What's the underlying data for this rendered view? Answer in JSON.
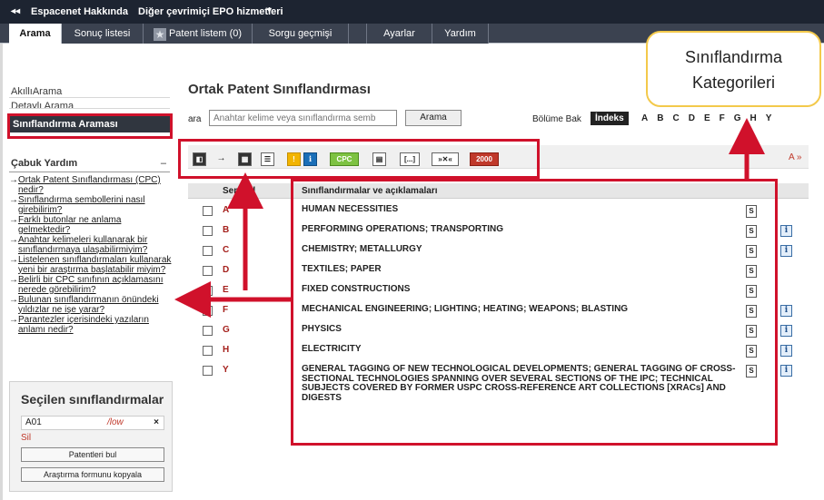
{
  "topbar": {
    "home_glyph": "◂◂",
    "espacenet_about": "Espacenet Hakkında",
    "other_services": "Diğer çevrimiçi EPO hizmetleri",
    "dropdown_caret": "▼"
  },
  "tabs": [
    {
      "label": "Arama",
      "active": true
    },
    {
      "label": "Sonuç listesi",
      "active": false
    },
    {
      "label": "Patent listem (0)",
      "active": false,
      "icon": "star-icon"
    },
    {
      "label": "Sorgu geçmişi",
      "active": false
    },
    {
      "label": "Ayarlar",
      "active": false
    },
    {
      "label": "Yardım",
      "active": false
    }
  ],
  "left_nav": {
    "items": [
      "AkıllıArama",
      "Detaylı Arama"
    ],
    "selected": "Sınıflandırma Araması"
  },
  "quick_help": {
    "title": "Çabuk Yardım",
    "collapse": "–",
    "links": [
      "Ortak Patent Sınıflandırması (CPC) nedir?",
      "Sınıflandırma sembollerini nasıl girebilirim?",
      "Farklı butonlar ne anlama gelmektedir?",
      "Anahtar kelimeleri kullanarak bir sınıflandırmaya ulaşabilirmiyim?",
      "Listelenen sınıflandırmaları kullanarak yeni bir araştırma başlatabilir miyim?",
      "Belirli bir CPC sınıfının açıklamasını nerede görebilirim?",
      "Bulunan sınıflandırmanın önündeki yıldızlar ne işe yarar?",
      "Parantezler içerisindeki yazıların anlamı nedir?"
    ]
  },
  "selected_panel": {
    "title": "Seçilen sınıflandırmalar",
    "item_code": "A01",
    "item_op": "/low",
    "remove": "×",
    "delete_label": "Sil",
    "find_patents": "Patentleri bul",
    "copy_form": "Araştırma formunu kopyala"
  },
  "main": {
    "title": "Ortak Patent Sınıflandırması",
    "search_label": "ara",
    "search_placeholder": "Anahtar kelime veya sınıflandırma semb",
    "search_button": "Arama",
    "section_label": "Bölüme Bak",
    "index_label": "İndeks",
    "section_letters": [
      "A",
      "B",
      "C",
      "D",
      "E",
      "F",
      "G",
      "H",
      "Y"
    ],
    "font_link": "A »"
  },
  "toolbar": {
    "items": [
      {
        "name": "collapse-all-icon",
        "glyph": "◧"
      },
      {
        "name": "go-to-icon",
        "glyph": "→"
      },
      {
        "name": "expand-view-icon",
        "glyph": "▦"
      },
      {
        "name": "list-view-icon",
        "glyph": "☰"
      },
      {
        "name": "warning-icon",
        "glyph": "!"
      },
      {
        "name": "info-icon",
        "glyph": "i"
      },
      {
        "name": "cpc-icon",
        "glyph": "CPC"
      },
      {
        "name": "table-icon",
        "glyph": "▤"
      },
      {
        "name": "brackets-icon",
        "glyph": "[...]"
      },
      {
        "name": "concordance-icon",
        "glyph": "»✕«"
      },
      {
        "name": "year-2000-icon",
        "glyph": "2000"
      }
    ]
  },
  "table": {
    "headers": [
      "Sembol",
      "Sınıflandırmalar ve açıklamaları"
    ],
    "rows": [
      {
        "symbol": "A",
        "desc": "HUMAN NECESSITIES",
        "info": false
      },
      {
        "symbol": "B",
        "desc": "PERFORMING OPERATIONS; TRANSPORTING",
        "info": true
      },
      {
        "symbol": "C",
        "desc": "CHEMISTRY; METALLURGY",
        "info": true
      },
      {
        "symbol": "D",
        "desc": "TEXTILES; PAPER",
        "info": false
      },
      {
        "symbol": "E",
        "desc": "FIXED CONSTRUCTIONS",
        "info": false
      },
      {
        "symbol": "F",
        "desc": "MECHANICAL ENGINEERING; LIGHTING; HEATING; WEAPONS; BLASTING",
        "info": true
      },
      {
        "symbol": "G",
        "desc": "PHYSICS",
        "info": true
      },
      {
        "symbol": "H",
        "desc": "ELECTRICITY",
        "info": true
      },
      {
        "symbol": "Y",
        "desc": "GENERAL TAGGING OF NEW TECHNOLOGICAL DEVELOPMENTS; GENERAL TAGGING OF CROSS-SECTIONAL TECHNOLOGIES SPANNING OVER SEVERAL SECTIONS OF THE IPC; TECHNICAL SUBJECTS COVERED BY FORMER USPC CROSS-REFERENCE ART COLLECTIONS [XRACs] AND DIGESTS",
        "info": true
      }
    ],
    "s_glyph": "S",
    "i_glyph": "i"
  },
  "annotation": {
    "callout_line1": "Sınıflandırma",
    "callout_line2": "Kategorileri"
  },
  "colors": {
    "topbar": "#1d2431",
    "accent_red": "#d0112b",
    "callout_border": "#f3c94b",
    "symbol_red": "#a5201c"
  }
}
